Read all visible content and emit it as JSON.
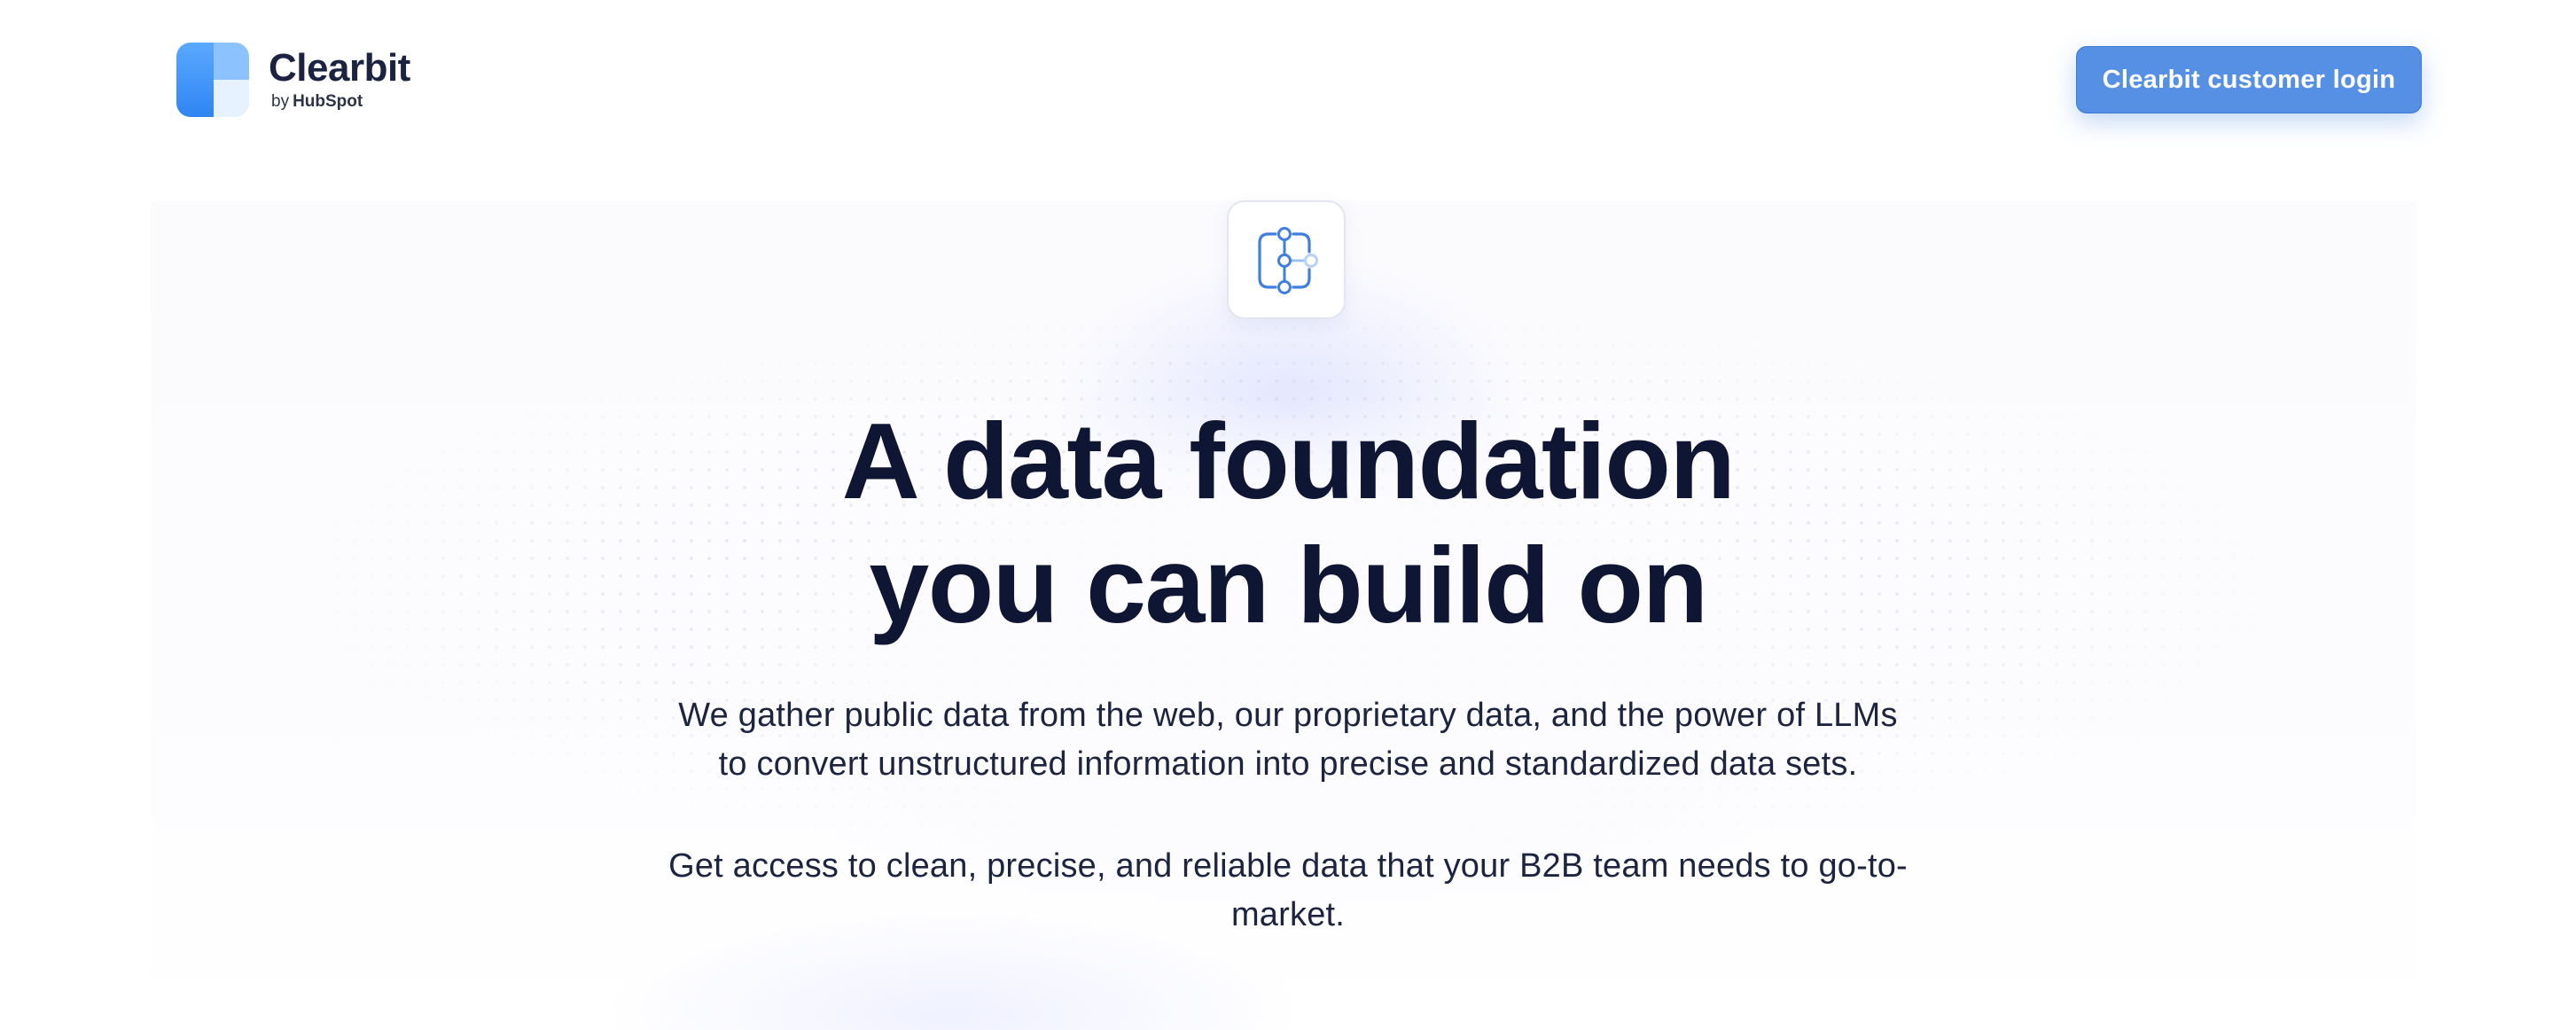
{
  "header": {
    "logo": {
      "wordmark": "Clearbit",
      "byline_prefix": "by",
      "byline_brand": "HubSpot"
    },
    "login_button": "Clearbit customer login"
  },
  "hero": {
    "icon": "connected-nodes-icon",
    "title_line1": "A data foundation",
    "title_line2": "you can build on",
    "paragraph1_line1": "We gather public data from the web, our proprietary data, and the power of LLMs",
    "paragraph1_line2": "to convert unstructured information into precise and standardized data sets.",
    "paragraph2_line1": "Get access to clean, precise, and reliable data that your B2B team needs to go-to-",
    "paragraph2_line2": "market."
  },
  "colors": {
    "accent": "#5590e4",
    "heading": "#0f1633",
    "body_text": "#1d2440",
    "logo_blue": "#2f84f2",
    "hubspot_orange": "#ff5c35"
  }
}
